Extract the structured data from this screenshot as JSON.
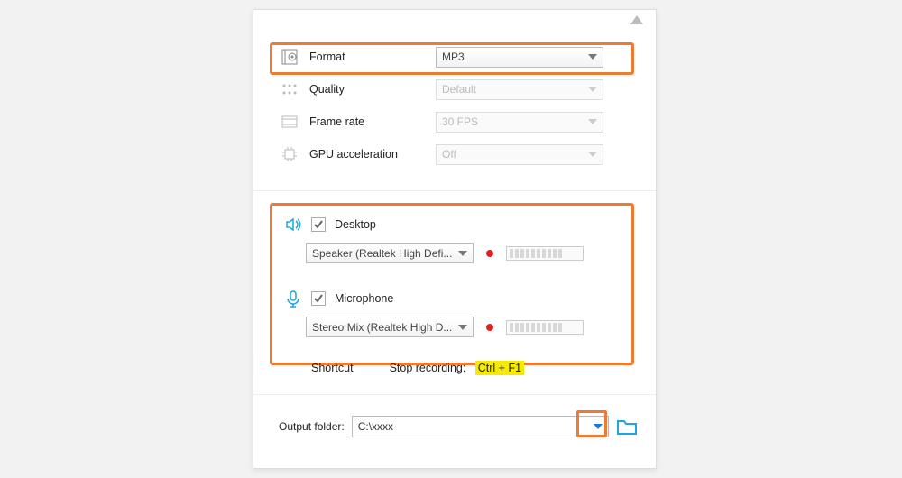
{
  "settings": {
    "format": {
      "label": "Format",
      "value": "MP3"
    },
    "quality": {
      "label": "Quality",
      "value": "Default"
    },
    "frame_rate": {
      "label": "Frame rate",
      "value": "30 FPS"
    },
    "gpu": {
      "label": "GPU acceleration",
      "value": "Off"
    }
  },
  "audio": {
    "desktop": {
      "label": "Desktop",
      "device": "Speaker (Realtek High Defi..."
    },
    "mic": {
      "label": "Microphone",
      "device": "Stereo Mix (Realtek High D..."
    }
  },
  "shortcut": {
    "label": "Shortcut",
    "stop_label": "Stop recording:",
    "stop_key": "Ctrl + F1"
  },
  "output": {
    "label": "Output folder:",
    "path": "C:\\xxxx"
  }
}
